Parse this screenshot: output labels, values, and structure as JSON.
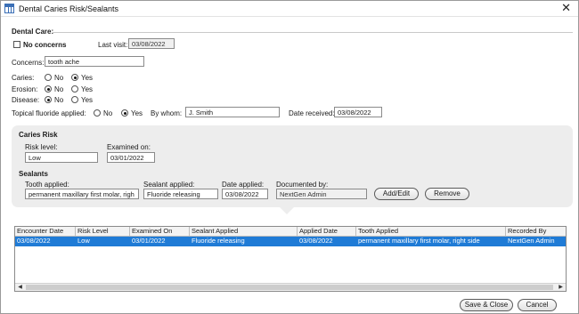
{
  "window": {
    "title": "Dental Caries Risk/Sealants",
    "close_glyph": "✕"
  },
  "dental_care": {
    "heading": "Dental Care:",
    "no_concerns_label": "No concerns",
    "last_visit_label": "Last visit:",
    "last_visit_value": "03/08/2022",
    "concerns_label": "Concerns:",
    "concerns_value": "tooth ache",
    "caries_label": "Caries:",
    "erosion_label": "Erosion:",
    "disease_label": "Disease:",
    "no_label": "No",
    "yes_label": "Yes",
    "caries_value": "Yes",
    "erosion_value": "No",
    "disease_value": "No",
    "fluoride_label": "Topical fluoride applied:",
    "fluoride_value": "Yes",
    "by_whom_label": "By whom:",
    "by_whom_value": "J. Smith",
    "date_received_label": "Date received:",
    "date_received_value": "03/08/2022"
  },
  "caries_risk": {
    "heading": "Caries Risk",
    "risk_level_label": "Risk level:",
    "risk_level_value": "Low",
    "examined_on_label": "Examined on:",
    "examined_on_value": "03/01/2022"
  },
  "sealants": {
    "heading": "Sealants",
    "tooth_label": "Tooth applied:",
    "tooth_value": "permanent maxillary first molar, righ",
    "sealant_label": "Sealant applied:",
    "sealant_value": "Fluoride releasing",
    "date_label": "Date applied:",
    "date_value": "03/08/2022",
    "documented_label": "Documented by:",
    "documented_value": "NextGen Admin",
    "add_edit_label": "Add/Edit",
    "remove_label": "Remove"
  },
  "grid": {
    "columns": [
      "Encounter Date",
      "Risk Level",
      "Examined On",
      "Sealant Applied",
      "Applied Date",
      "Tooth Applied",
      "Recorded By"
    ],
    "rows": [
      [
        "03/08/2022",
        "Low",
        "03/01/2022",
        "Fluoride releasing",
        "03/08/2022",
        "permanent maxillary first molar, right side",
        "NextGen Admin"
      ]
    ],
    "scroll_left": "◀",
    "scroll_right": "▶"
  },
  "footer": {
    "save_close_label": "Save & Close",
    "cancel_label": "Cancel"
  },
  "colors": {
    "selection": "#1f7bd6",
    "panel": "#ededed"
  }
}
